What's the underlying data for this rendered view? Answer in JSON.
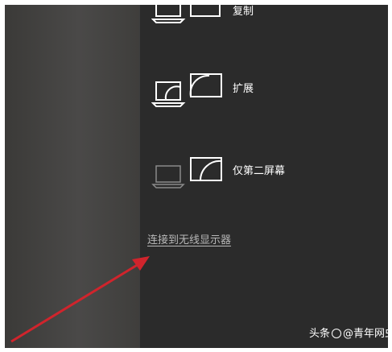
{
  "project_panel": {
    "options": [
      {
        "label": "复制",
        "icon": "duplicate-displays-icon"
      },
      {
        "label": "扩展",
        "icon": "extend-displays-icon"
      },
      {
        "label": "仅第二屏幕",
        "icon": "second-screen-only-icon"
      }
    ],
    "wireless_link": "连接到无线显示器"
  },
  "watermark": {
    "prefix": "头条",
    "handle": "@青年网虫"
  },
  "colors": {
    "panel_bg": "#2b2b2b",
    "text": "#ffffff",
    "link": "#b8b8b8",
    "arrow": "#d0242c"
  }
}
